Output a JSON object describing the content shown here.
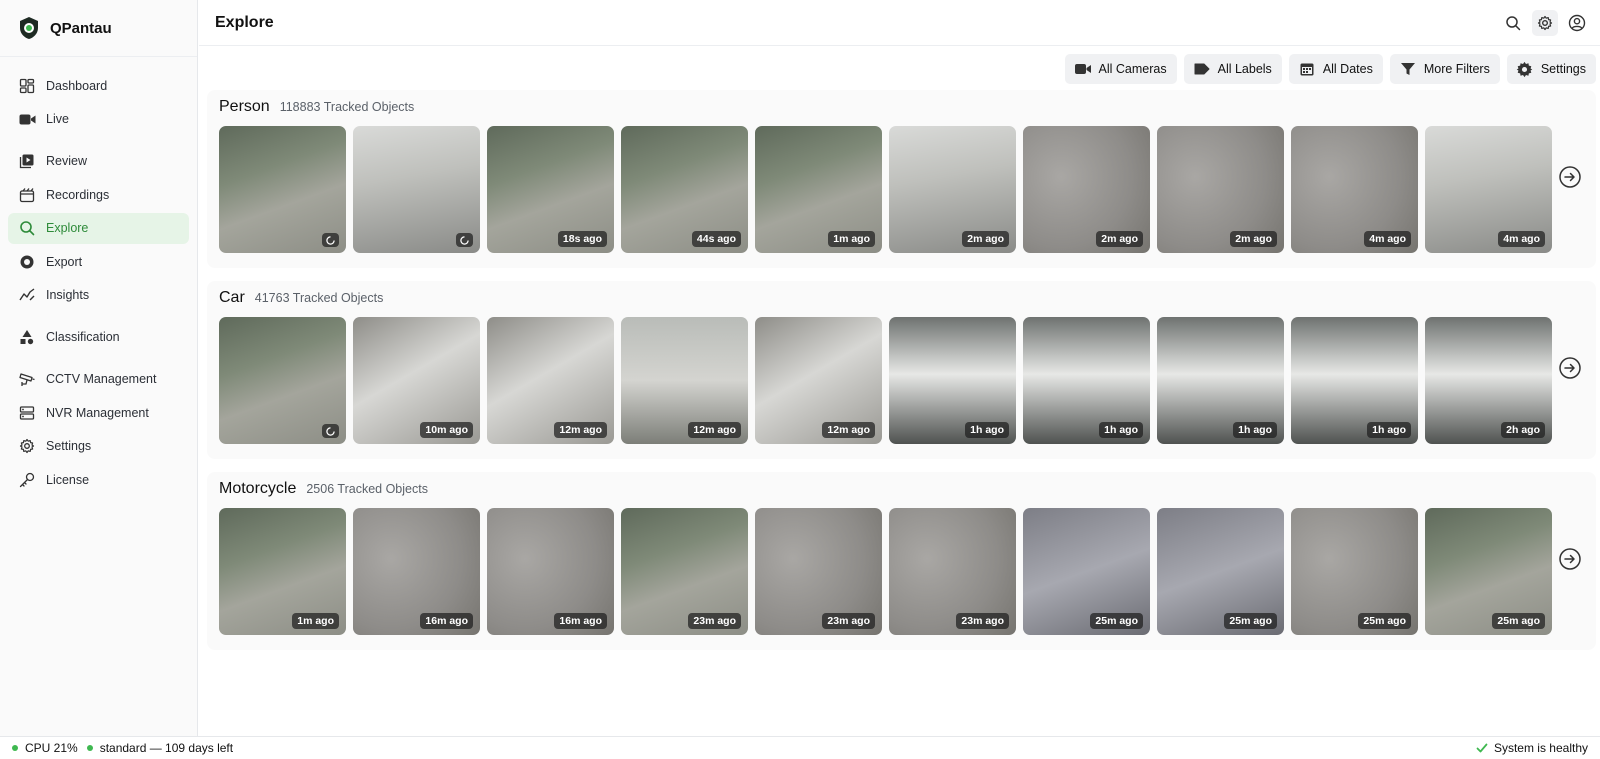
{
  "app": {
    "name": "QPantau"
  },
  "nav": [
    {
      "label": "Dashboard",
      "icon": "dashboard-icon"
    },
    {
      "label": "Live",
      "icon": "video-camera-icon"
    },
    {
      "label": "Review",
      "icon": "review-icon"
    },
    {
      "label": "Recordings",
      "icon": "recordings-icon"
    },
    {
      "label": "Explore",
      "icon": "search-icon",
      "active": true
    },
    {
      "label": "Export",
      "icon": "export-icon"
    },
    {
      "label": "Insights",
      "icon": "chart-line-icon"
    },
    {
      "label": "Classification",
      "icon": "shapes-icon"
    },
    {
      "label": "CCTV Management",
      "icon": "cctv-icon"
    },
    {
      "label": "NVR Management",
      "icon": "server-icon"
    },
    {
      "label": "Settings",
      "icon": "gear-icon"
    },
    {
      "label": "License",
      "icon": "key-icon"
    }
  ],
  "header": {
    "title": "Explore"
  },
  "filters": {
    "cameras": "All Cameras",
    "labels": "All Labels",
    "dates": "All Dates",
    "more": "More Filters",
    "settings": "Settings"
  },
  "sections": [
    {
      "title": "Person",
      "count": "118883 Tracked Objects",
      "items": [
        {
          "time": "",
          "loading": true,
          "scene": "plaza"
        },
        {
          "time": "",
          "loading": true,
          "scene": "lobby"
        },
        {
          "time": "18s ago",
          "scene": "plaza"
        },
        {
          "time": "44s ago",
          "scene": "plaza"
        },
        {
          "time": "1m ago",
          "scene": "plaza"
        },
        {
          "time": "2m ago",
          "scene": "lobby"
        },
        {
          "time": "2m ago",
          "scene": "paving"
        },
        {
          "time": "2m ago",
          "scene": "paving"
        },
        {
          "time": "4m ago",
          "scene": "paving"
        },
        {
          "time": "4m ago",
          "scene": "lobby"
        }
      ]
    },
    {
      "title": "Car",
      "count": "41763 Tracked Objects",
      "items": [
        {
          "time": "",
          "loading": true,
          "scene": "plaza"
        },
        {
          "time": "10m ago",
          "scene": "van"
        },
        {
          "time": "12m ago",
          "scene": "van"
        },
        {
          "time": "12m ago",
          "scene": "street"
        },
        {
          "time": "12m ago",
          "scene": "van"
        },
        {
          "time": "1h ago",
          "scene": "parking"
        },
        {
          "time": "1h ago",
          "scene": "parking"
        },
        {
          "time": "1h ago",
          "scene": "parking"
        },
        {
          "time": "1h ago",
          "scene": "parking"
        },
        {
          "time": "2h ago",
          "scene": "parking"
        }
      ]
    },
    {
      "title": "Motorcycle",
      "count": "2506 Tracked Objects",
      "items": [
        {
          "time": "1m ago",
          "scene": "plaza"
        },
        {
          "time": "16m ago",
          "scene": "paving"
        },
        {
          "time": "16m ago",
          "scene": "paving"
        },
        {
          "time": "23m ago",
          "scene": "plaza"
        },
        {
          "time": "23m ago",
          "scene": "paving"
        },
        {
          "time": "23m ago",
          "scene": "paving"
        },
        {
          "time": "25m ago",
          "scene": "blur"
        },
        {
          "time": "25m ago",
          "scene": "blur"
        },
        {
          "time": "25m ago",
          "scene": "paving"
        },
        {
          "time": "25m ago",
          "scene": "plaza"
        }
      ]
    }
  ],
  "footer": {
    "cpu": "CPU 21%",
    "license": "standard — 109 days left",
    "status": "System is healthy"
  },
  "colors": {
    "accent": "#2e8b3a",
    "status_green": "#3fb850"
  }
}
